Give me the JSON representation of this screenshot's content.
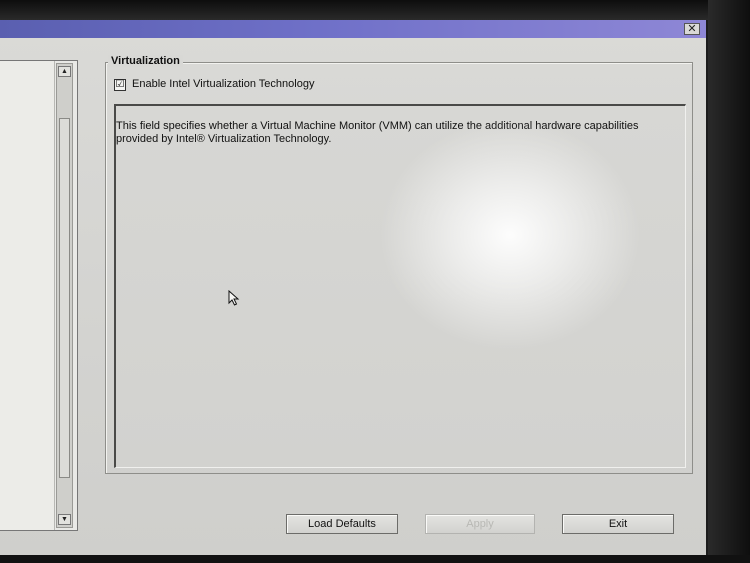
{
  "window": {
    "close_glyph": "✕"
  },
  "left_panel": {
    "scroll_up_glyph": "▲",
    "scroll_down_glyph": "▼"
  },
  "group": {
    "title": "Virtualization",
    "checkbox": {
      "label": "Enable Intel Virtualization Technology",
      "checked": true,
      "check_glyph": "☑"
    }
  },
  "description": "This field specifies whether a Virtual Machine Monitor (VMM) can utilize the additional hardware capabilities provided by Intel® Virtualization Technology.",
  "buttons": {
    "load_defaults": "Load Defaults",
    "apply": "Apply",
    "exit": "Exit"
  },
  "colors": {
    "title_bar": "#6f70c8",
    "panel": "#d6d6d3",
    "disabled_text": "#b8b8b4"
  },
  "icons": [
    "close-icon",
    "scroll-up-arrow-icon",
    "scroll-down-arrow-icon",
    "checkmark-icon",
    "mouse-pointer-icon"
  ]
}
